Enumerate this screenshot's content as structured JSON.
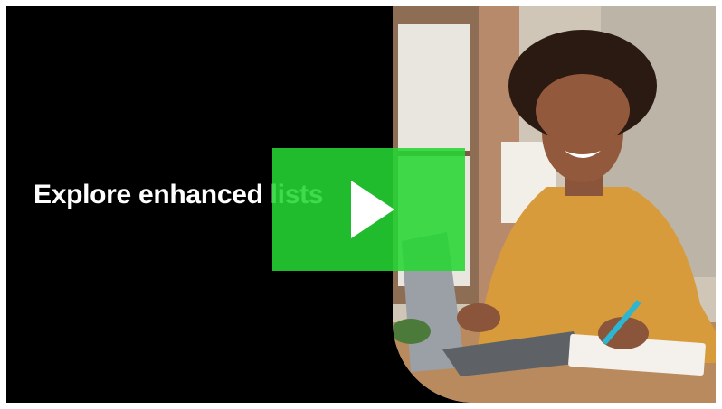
{
  "video": {
    "title": "Explore enhanced lists",
    "play_label": "",
    "accent_color": "#26d634",
    "thumbnail_subject": "woman smiling at laptop writing in notebook"
  },
  "icons": {
    "play": "play-icon"
  }
}
